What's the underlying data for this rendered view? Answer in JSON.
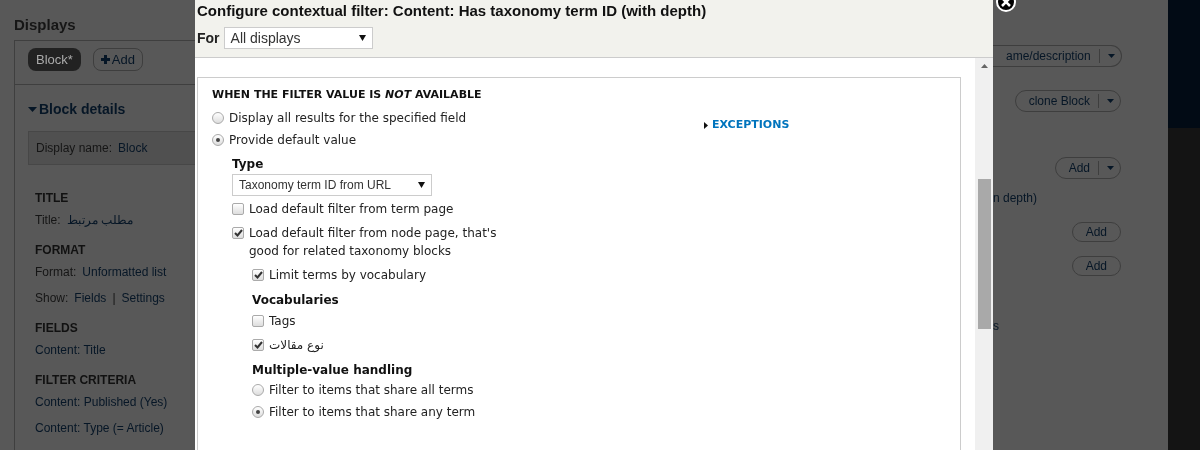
{
  "background": {
    "heading": "Displays",
    "display_tabs": [
      {
        "label": "Block*",
        "kind": "tab",
        "selected": true
      },
      {
        "label": "Add",
        "kind": "add"
      }
    ],
    "details_title": "Block details",
    "rows": [
      {
        "kind": "box",
        "parts": [
          {
            "text": "Display name:",
            "kind": "label"
          },
          {
            "text": "Block",
            "kind": "link"
          }
        ]
      },
      {
        "kind": "heading",
        "parts": [
          {
            "text": "TITLE",
            "kind": "label"
          }
        ]
      },
      {
        "kind": "row",
        "parts": [
          {
            "text": "Title:",
            "kind": "label"
          },
          {
            "text": "مطلب مرتبط",
            "kind": "link"
          }
        ]
      },
      {
        "kind": "heading",
        "parts": [
          {
            "text": "FORMAT",
            "kind": "label"
          }
        ]
      },
      {
        "kind": "row",
        "parts": [
          {
            "text": "Format:",
            "kind": "label"
          },
          {
            "text": "Unformatted list",
            "kind": "link"
          }
        ]
      },
      {
        "kind": "row",
        "parts": [
          {
            "text": "Show:",
            "kind": "label"
          },
          {
            "text": "Fields",
            "kind": "link"
          },
          {
            "text": "|",
            "kind": "label"
          },
          {
            "text": "Settings",
            "kind": "link"
          }
        ]
      },
      {
        "kind": "heading",
        "parts": [
          {
            "text": "FIELDS",
            "kind": "label"
          }
        ]
      },
      {
        "kind": "row",
        "parts": [
          {
            "text": "Content: Title",
            "kind": "link"
          }
        ]
      },
      {
        "kind": "heading",
        "parts": [
          {
            "text": "FILTER CRITERIA",
            "kind": "label"
          }
        ]
      },
      {
        "kind": "row",
        "parts": [
          {
            "text": "Content: Published (Yes)",
            "kind": "link"
          }
        ]
      },
      {
        "kind": "row",
        "parts": [
          {
            "text": "Content: Type (= Article)",
            "kind": "link"
          }
        ]
      }
    ],
    "right_items": [
      {
        "kind": "split",
        "label": "ame/description"
      },
      {
        "kind": "split",
        "label": "clone Block"
      },
      {
        "kind": "split",
        "label": "Add"
      },
      {
        "kind": "link",
        "label": "n depth)"
      },
      {
        "kind": "button",
        "label": "Add"
      },
      {
        "kind": "button",
        "label": "Add"
      },
      {
        "kind": "link",
        "label": "s"
      }
    ]
  },
  "modal": {
    "title": "Configure contextual filter: Content: Has taxonomy term ID (with depth)",
    "for_label": "For",
    "for_select": "All displays",
    "fieldset_title": "WHEN THE FILTER VALUE IS *NOT* AVAILABLE",
    "exceptions_link": "EXCEPTIONS",
    "items": [
      {
        "kind": "radio",
        "label": "Display all results for the specified field",
        "selected": false
      },
      {
        "kind": "radio",
        "label": "Provide default value",
        "selected": true,
        "children": [
          {
            "kind": "heading",
            "label": "Type"
          },
          {
            "kind": "select",
            "label": "Taxonomy term ID from URL"
          },
          {
            "kind": "checkbox",
            "label": "Load default filter from term page",
            "checked": false
          },
          {
            "kind": "checkbox",
            "label": "Load default filter from node page, that's good for related taxonomy blocks",
            "checked": true,
            "children": [
              {
                "kind": "checkbox",
                "label": "Limit terms by vocabulary",
                "checked": true
              },
              {
                "kind": "heading",
                "label": "Vocabularies"
              },
              {
                "kind": "checkbox",
                "label": "Tags",
                "checked": false
              },
              {
                "kind": "checkbox",
                "label": "نوع مقالات",
                "checked": true
              },
              {
                "kind": "heading",
                "label": "Multiple-value handling"
              },
              {
                "kind": "radio",
                "label": "Filter to items that share all terms",
                "selected": false
              },
              {
                "kind": "radio",
                "label": "Filter to items that share any term",
                "selected": true
              }
            ]
          }
        ]
      }
    ]
  }
}
